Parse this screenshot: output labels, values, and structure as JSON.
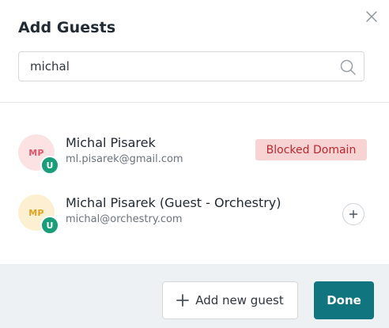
{
  "dialog": {
    "title": "Add Guests"
  },
  "search": {
    "value": "michal",
    "placeholder": ""
  },
  "guests": [
    {
      "initials": "MP",
      "badge": "U",
      "name": "Michal Pisarek",
      "email": "ml.pisarek@gmail.com",
      "status": "Blocked Domain",
      "avatar_bg": "#fde2e3",
      "avatar_fg": "#e0566b"
    },
    {
      "initials": "MP",
      "badge": "U",
      "name": "Michal Pisarek (Guest - Orchestry)",
      "email": "michal@orchestry.com",
      "status": "",
      "avatar_bg": "#fdf0d2",
      "avatar_fg": "#e0a21f"
    }
  ],
  "footer": {
    "add_new_guest_label": "Add new guest",
    "done_label": "Done"
  },
  "colors": {
    "accent": "#11757f",
    "badge_green": "#1a9e7a",
    "blocked_bg": "#f8d3d4",
    "blocked_text": "#c0272d",
    "footer_bg": "#eef1f4"
  },
  "icons": {
    "close": "close-icon",
    "search": "search-icon",
    "add": "plus-icon"
  }
}
